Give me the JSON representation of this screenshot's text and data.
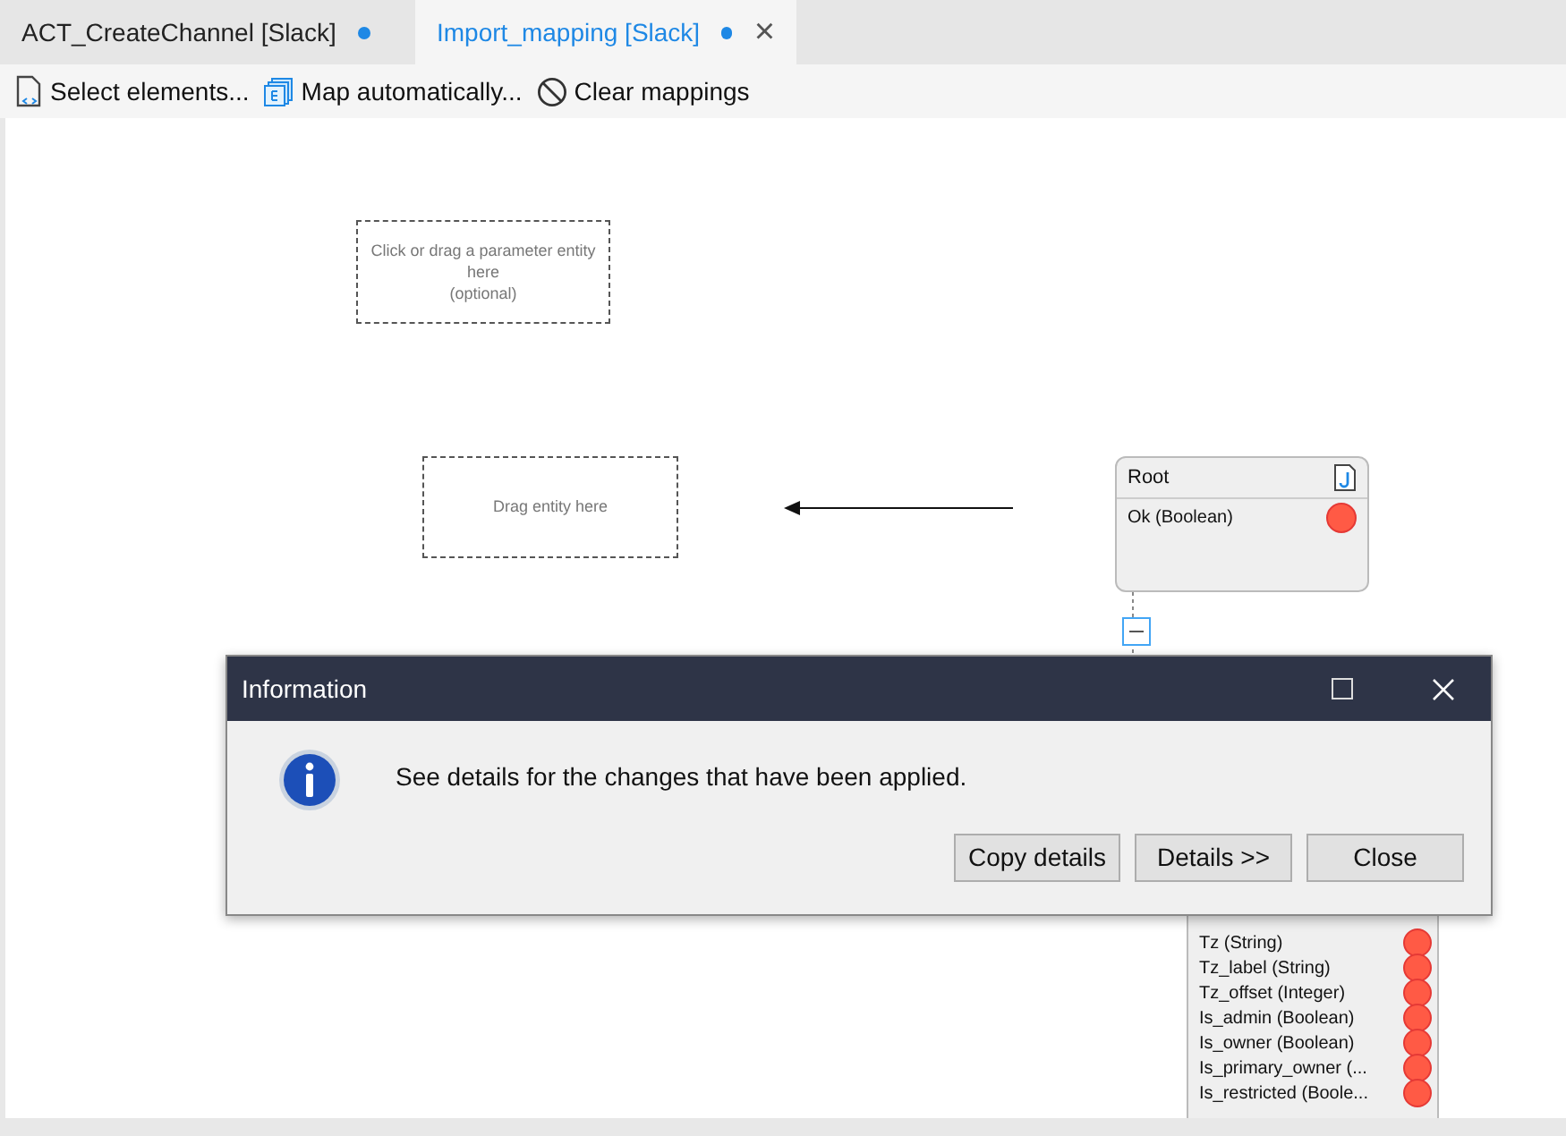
{
  "tabs": [
    {
      "label": "ACT_CreateChannel [Slack]",
      "selected": false,
      "modified": true
    },
    {
      "label": "Import_mapping [Slack]",
      "selected": true,
      "modified": true,
      "closable": "×"
    }
  ],
  "toolbar": [
    {
      "kind": "select",
      "label": "Select elements..."
    },
    {
      "kind": "map",
      "label": "Map automatically..."
    },
    {
      "kind": "clear",
      "label": "Clear mappings"
    }
  ],
  "canvas": {
    "parameter_drop": {
      "lines": [
        "Click or drag a parameter entity",
        "here",
        "(optional)"
      ]
    },
    "entity_drop": {
      "label": "Drag entity here"
    },
    "root": {
      "title": "Root",
      "attributes": [
        {
          "label": "Ok (Boolean)"
        }
      ]
    },
    "entity": {
      "attributes": [
        {
          "label": "Tz (String)"
        },
        {
          "label": "Tz_label (String)"
        },
        {
          "label": "Tz_offset (Integer)"
        },
        {
          "label": "Is_admin (Boolean)"
        },
        {
          "label": "Is_owner (Boolean)"
        },
        {
          "label": "Is_primary_owner  (..."
        },
        {
          "label": "Is_restricted  (Boole..."
        }
      ]
    }
  },
  "dialog": {
    "title": "Information",
    "message": "See details for the changes that have been applied.",
    "buttons": [
      "Copy details",
      "Details >>",
      "Close"
    ]
  }
}
